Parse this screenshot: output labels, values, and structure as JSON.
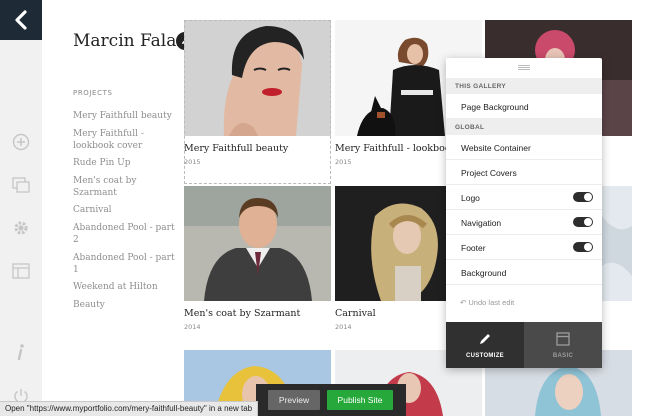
{
  "toolbar": {
    "back_icon": "chevron-left-icon",
    "tools": [
      "add-icon",
      "pages-icon",
      "gear-icon",
      "layout-icon",
      "info-icon",
      "power-icon"
    ]
  },
  "sidebar": {
    "site_title": "Marcin Falana",
    "projects_heading": "PROJECTS",
    "projects": [
      "Mery Faithfull beauty",
      "Mery Faithfull - lookbook cover",
      "Rude Pin Up",
      "Men's coat by Szarmant",
      "Carnival",
      "Abandoned Pool - part 2",
      "Abandoned Pool - part 1",
      "Weekend at Hilton",
      "Beauty"
    ]
  },
  "gallery": {
    "items": [
      {
        "title": "Mery Faithfull beauty",
        "year": "2015"
      },
      {
        "title": "Mery Faithfull - lookbook cover",
        "year": "2015"
      },
      {
        "title": "Men's coat by Szarmant",
        "year": "2014"
      },
      {
        "title": "Carnival",
        "year": "2014"
      }
    ]
  },
  "panel": {
    "this_gallery_label": "THIS GALLERY",
    "page_background": "Page Background",
    "global_label": "GLOBAL",
    "website_container": "Website Container",
    "project_covers": "Project Covers",
    "logo": "Logo",
    "navigation": "Navigation",
    "footer": "Footer",
    "background": "Background",
    "toggles": {
      "logo": true,
      "navigation": true,
      "footer": true
    },
    "undo": "Undo last edit",
    "tab_customize": "CUSTOMIZE",
    "tab_basic": "BASIC"
  },
  "bottom": {
    "preview": "Preview",
    "publish": "Publish Site",
    "publish_color": "#27a83a"
  },
  "status_bar": "Open \"https://www.myportfolio.com/mery-faithfull-beauty\" in a new tab"
}
